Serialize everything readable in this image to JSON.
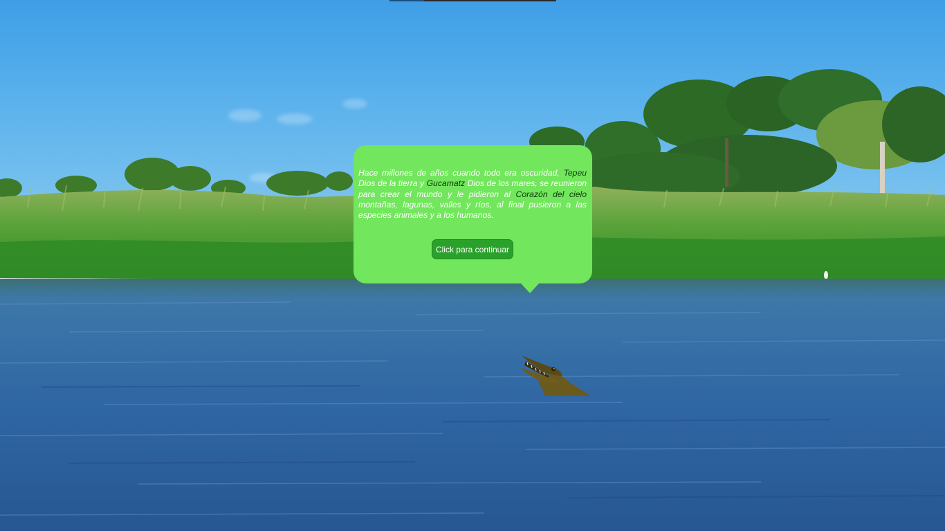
{
  "scene": {
    "background": "river-landscape",
    "sky_color": "#4aa6ea",
    "water_color": "#2c5f9a",
    "vegetation_color": "#3f9a2c"
  },
  "dialog": {
    "bubble_color": "#72e65c",
    "story_parts": [
      "Hace millones de años cuando todo era oscuridad, ",
      "Tepeu",
      " Dios de la tierra y ",
      "Gucamatz",
      " Dios de los mares, se reunieron para crear el mundo y le pidieron al ",
      "Corazón del cielo",
      " montañas, lagunas, valles y ríos, al final pusieron a las especies animales y a los humanos."
    ],
    "button_label": "Click para continuar",
    "button_color": "#2aa12a"
  },
  "character": {
    "icon": "crocodile-icon",
    "color": "#6b5a1e"
  }
}
